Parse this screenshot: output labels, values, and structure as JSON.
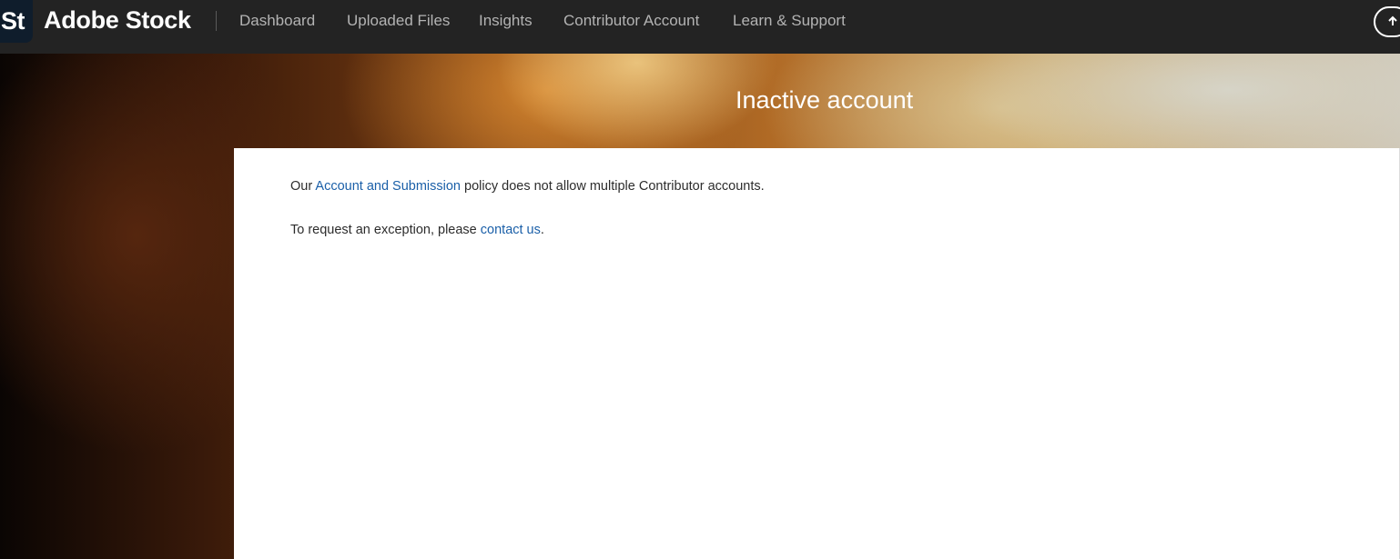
{
  "header": {
    "logo_mark": "St",
    "brand": "Adobe Stock",
    "nav": [
      {
        "label": "Dashboard"
      },
      {
        "label": "Uploaded Files"
      },
      {
        "label": "Insights"
      },
      {
        "label": "Contributor Account"
      },
      {
        "label": "Learn & Support"
      }
    ],
    "upload_icon": "cloud-upload-icon"
  },
  "hero": {
    "title": "Inactive account"
  },
  "content": {
    "p1_prefix": "Our ",
    "p1_link": "Account and Submission",
    "p1_suffix": " policy does not allow multiple Contributor accounts.",
    "p2_prefix": "To request an exception, please ",
    "p2_link": "contact us",
    "p2_suffix": "."
  },
  "colors": {
    "topbar": "#232323",
    "link": "#1a5fa8",
    "text": "#2c2c2c"
  }
}
